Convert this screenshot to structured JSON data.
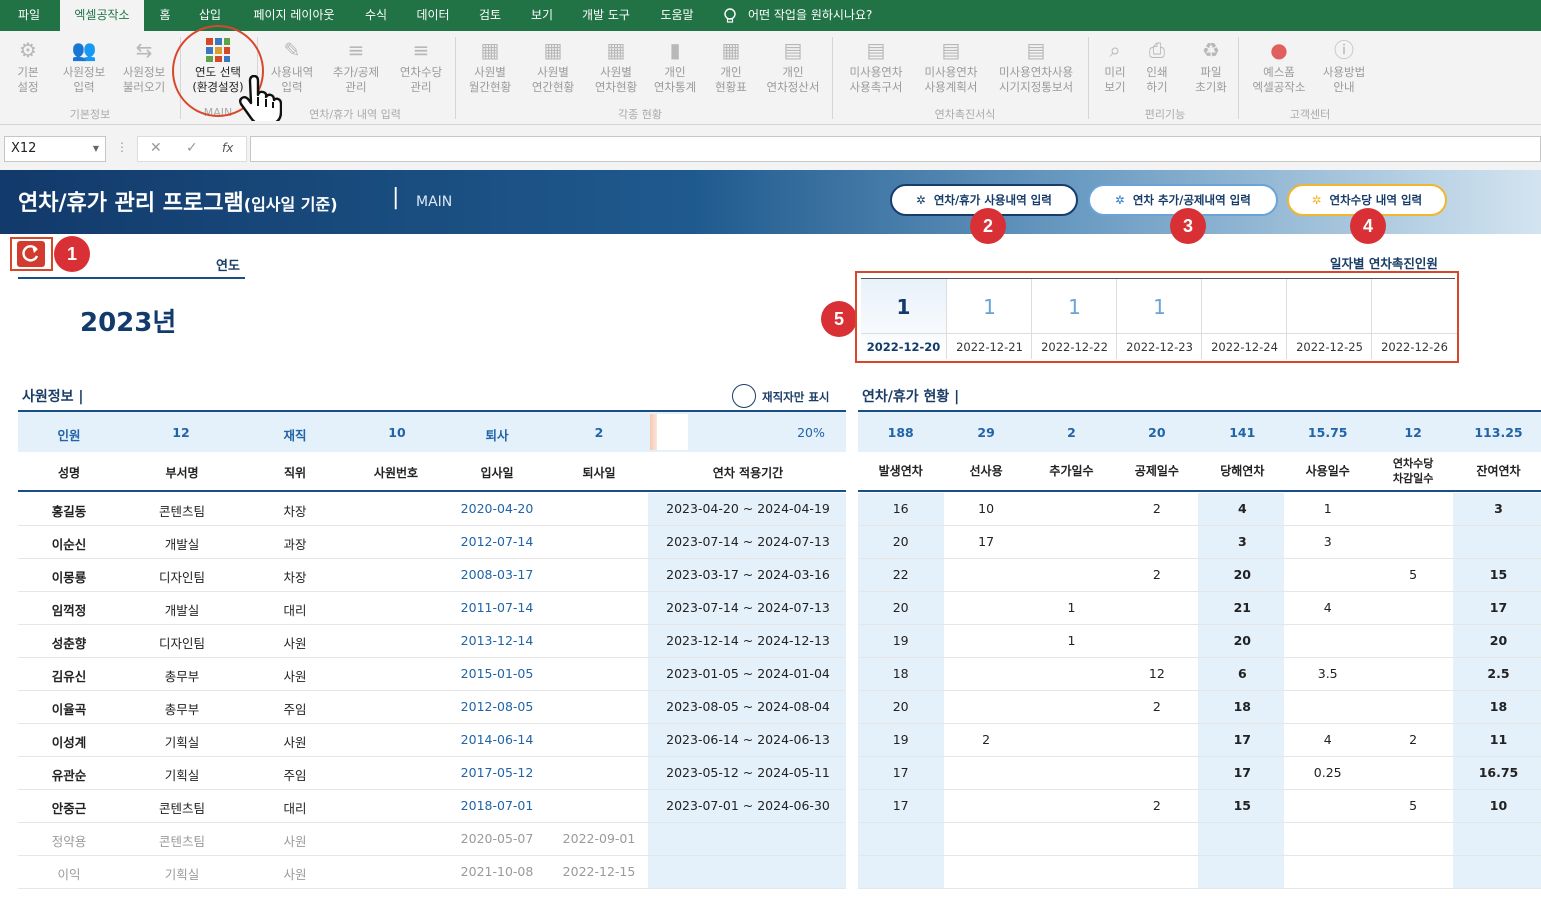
{
  "menu": {
    "tabs": [
      "파일",
      "엑셀공작소",
      "홈",
      "삽입",
      "페이지 레이아웃",
      "수식",
      "데이터",
      "검토",
      "보기",
      "개발 도구",
      "도움말"
    ],
    "search_label": "어떤 작업을 원하시나요?"
  },
  "ribbon": {
    "buttons": [
      {
        "l1": "기본",
        "l2": "설정"
      },
      {
        "l1": "사원정보",
        "l2": "입력"
      },
      {
        "l1": "사원정보",
        "l2": "불러오기"
      },
      {
        "l1": "연도 선택",
        "l2": "(환경설정)"
      },
      {
        "l1": "사용내역",
        "l2": "입력"
      },
      {
        "l1": "추가/공제",
        "l2": "관리"
      },
      {
        "l1": "연차수당",
        "l2": "관리"
      },
      {
        "l1": "사원별",
        "l2": "월간현황"
      },
      {
        "l1": "사원별",
        "l2": "연간현황"
      },
      {
        "l1": "사원별",
        "l2": "연차현황"
      },
      {
        "l1": "개인",
        "l2": "연차통계"
      },
      {
        "l1": "개인",
        "l2": "현황표"
      },
      {
        "l1": "개인",
        "l2": "연차정산서"
      },
      {
        "l1": "미사용연차",
        "l2": "사용촉구서"
      },
      {
        "l1": "미사용연차",
        "l2": "사용계획서"
      },
      {
        "l1": "미사용연차사용",
        "l2": "시기지정통보서"
      },
      {
        "l1": "미리",
        "l2": "보기"
      },
      {
        "l1": "인쇄",
        "l2": "하기"
      },
      {
        "l1": "파일",
        "l2": "초기화"
      },
      {
        "l1": "예스폼",
        "l2": "엑셀공작소"
      },
      {
        "l1": "사용방법",
        "l2": "안내"
      }
    ],
    "groups": [
      "기본정보",
      "MAIN",
      "연차/휴가 내역 입력",
      "각종 현황",
      "연차촉진서식",
      "편리기능",
      "고객센터"
    ]
  },
  "formula": {
    "cell_ref": "X12",
    "fx": "fx"
  },
  "banner": {
    "title": "연차/휴가 관리 프로그램",
    "title_sub": "(입사일 기준)",
    "divider": "|",
    "section": "MAIN",
    "btn_usage": "연차/휴가 사용내역 입력",
    "btn_adjust": "연차 추가/공제내역 입력",
    "btn_allowance": "연차수당 내역 입력"
  },
  "badges": [
    "1",
    "2",
    "3",
    "4",
    "5"
  ],
  "year": {
    "label": "연도",
    "value": "2023년"
  },
  "promo": {
    "title": "일자별 연차촉진인원",
    "counts": [
      "1",
      "1",
      "1",
      "1",
      "",
      "",
      ""
    ],
    "dates": [
      "2022-12-20",
      "2022-12-21",
      "2022-12-22",
      "2022-12-23",
      "2022-12-24",
      "2022-12-25",
      "2022-12-26"
    ]
  },
  "employees": {
    "title": "사원정보 |",
    "toggle_label": "재직자만 표시",
    "summary": {
      "total_label": "인원",
      "total": "12",
      "active_label": "재직",
      "active": "10",
      "left_label": "퇴사",
      "left": "2",
      "ratio": "20%",
      "ratio_value": 0.2
    },
    "headers": [
      "성명",
      "부서명",
      "직위",
      "사원번호",
      "입사일",
      "퇴사일",
      "연차 적용기간"
    ],
    "rows": [
      [
        "홍길동",
        "콘텐츠팀",
        "차장",
        "",
        "2020-04-20",
        "",
        "2023-04-20 ~ 2024-04-19"
      ],
      [
        "이순신",
        "개발실",
        "과장",
        "",
        "2012-07-14",
        "",
        "2023-07-14 ~ 2024-07-13"
      ],
      [
        "이몽룡",
        "디자인팀",
        "차장",
        "",
        "2008-03-17",
        "",
        "2023-03-17 ~ 2024-03-16"
      ],
      [
        "임꺽정",
        "개발실",
        "대리",
        "",
        "2011-07-14",
        "",
        "2023-07-14 ~ 2024-07-13"
      ],
      [
        "성춘향",
        "디자인팀",
        "사원",
        "",
        "2013-12-14",
        "",
        "2023-12-14 ~ 2024-12-13"
      ],
      [
        "김유신",
        "총무부",
        "사원",
        "",
        "2015-01-05",
        "",
        "2023-01-05 ~ 2024-01-04"
      ],
      [
        "이율곡",
        "총무부",
        "주임",
        "",
        "2012-08-05",
        "",
        "2023-08-05 ~ 2024-08-04"
      ],
      [
        "이성계",
        "기획실",
        "사원",
        "",
        "2014-06-14",
        "",
        "2023-06-14 ~ 2024-06-13"
      ],
      [
        "유관순",
        "기획실",
        "주임",
        "",
        "2017-05-12",
        "",
        "2023-05-12 ~ 2024-05-11"
      ],
      [
        "안중근",
        "콘텐츠팀",
        "대리",
        "",
        "2018-07-01",
        "",
        "2023-07-01 ~ 2024-06-30"
      ],
      [
        "정약용",
        "콘텐츠팀",
        "사원",
        "",
        "2020-05-07",
        "2022-09-01",
        ""
      ],
      [
        "이익",
        "기획실",
        "사원",
        "",
        "2021-10-08",
        "2022-12-15",
        ""
      ]
    ]
  },
  "leave": {
    "title": "연차/휴가 현황 |",
    "totals": [
      "188",
      "29",
      "2",
      "20",
      "141",
      "15.75",
      "12",
      "113.25"
    ],
    "headers": [
      "발생연차",
      "선사용",
      "추가일수",
      "공제일수",
      "당해연차",
      "사용일수",
      "연차수당\n차감일수",
      "잔여연차"
    ],
    "rows": [
      [
        "16",
        "10",
        "",
        "2",
        "4",
        "1",
        "",
        "3"
      ],
      [
        "20",
        "17",
        "",
        "",
        "3",
        "3",
        "",
        ""
      ],
      [
        "22",
        "",
        "",
        "2",
        "20",
        "",
        "5",
        "15"
      ],
      [
        "20",
        "",
        "1",
        "",
        "21",
        "4",
        "",
        "17"
      ],
      [
        "19",
        "",
        "1",
        "",
        "20",
        "",
        "",
        "20"
      ],
      [
        "18",
        "",
        "",
        "12",
        "6",
        "3.5",
        "",
        "2.5"
      ],
      [
        "20",
        "",
        "",
        "2",
        "18",
        "",
        "",
        "18"
      ],
      [
        "19",
        "2",
        "",
        "",
        "17",
        "4",
        "2",
        "11"
      ],
      [
        "17",
        "",
        "",
        "",
        "17",
        "0.25",
        "",
        "16.75"
      ],
      [
        "17",
        "",
        "",
        "2",
        "15",
        "",
        "5",
        "10"
      ],
      [
        "",
        "",
        "",
        "",
        "",
        "",
        "",
        ""
      ],
      [
        "",
        "",
        "",
        "",
        "",
        "",
        "",
        ""
      ]
    ]
  }
}
